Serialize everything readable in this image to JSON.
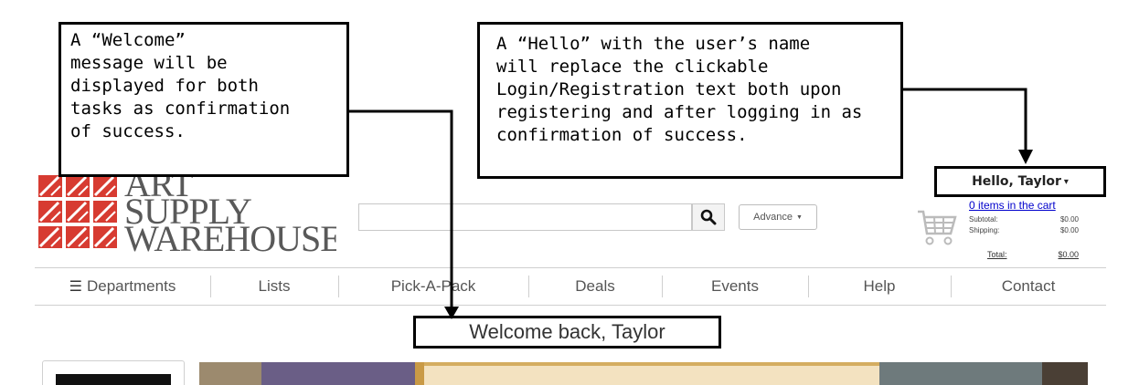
{
  "callouts": {
    "welcome_note": "A “Welcome”\nmessage will be\ndisplayed for both\ntasks as confirmation\nof success.",
    "hello_note": "A “Hello” with the user’s name\nwill replace the clickable\nLogin/Registration text both upon\nregistering and after logging in as\nconfirmation of success."
  },
  "header": {
    "logo": {
      "line1": "ART",
      "line2": "SUPPLY",
      "line3": "WAREHOUSE"
    },
    "search": {
      "value": "",
      "placeholder": ""
    },
    "advance_label": "Advance",
    "advance_icon": "caret-down",
    "search_icon": "magnifier",
    "user_greeting": "Hello, Taylor",
    "cart": {
      "link_text": "0 items in the cart",
      "subtotal_label": "Subtotal:",
      "subtotal_value": "$0.00",
      "shipping_label": "Shipping:",
      "shipping_value": "$0.00",
      "total_label": "Total:",
      "total_value": "$0.00"
    }
  },
  "nav": {
    "items": [
      {
        "label": "Departments",
        "icon": "hamburger"
      },
      {
        "label": "Lists"
      },
      {
        "label": "Pick-A-Pack"
      },
      {
        "label": "Deals"
      },
      {
        "label": "Events"
      },
      {
        "label": "Help"
      },
      {
        "label": "Contact"
      }
    ]
  },
  "main": {
    "welcome_message": "Welcome back, Taylor"
  },
  "colors": {
    "logo_red": "#d73b31",
    "link_blue": "#0000cc",
    "annotation_border": "#000000"
  }
}
